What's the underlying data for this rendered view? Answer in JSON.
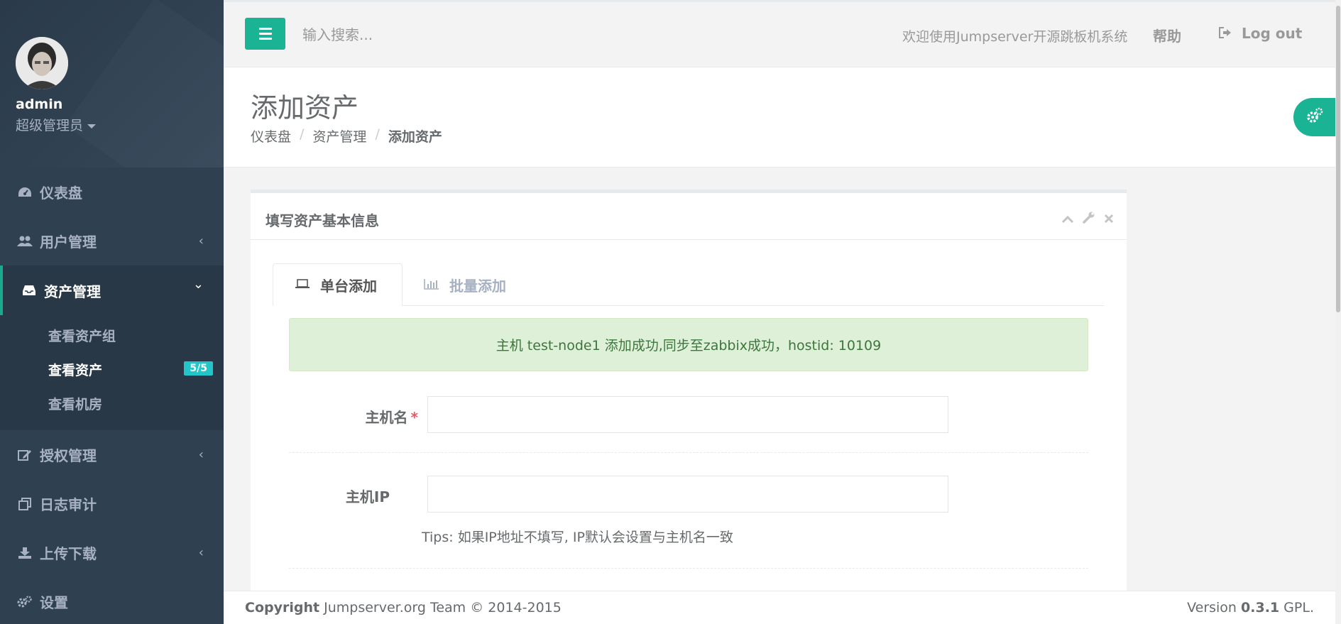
{
  "user": {
    "name": "admin",
    "role": "超级管理员"
  },
  "sidebar": {
    "items": [
      {
        "label": "仪表盘",
        "icon": "dashboard-icon"
      },
      {
        "label": "用户管理",
        "icon": "users-icon",
        "chevron": "‹"
      },
      {
        "label": "资产管理",
        "icon": "inbox-icon",
        "chevron": "⌄"
      },
      {
        "label": "授权管理",
        "icon": "edit-icon",
        "chevron": "‹"
      },
      {
        "label": "日志审计",
        "icon": "files-icon"
      },
      {
        "label": "上传下载",
        "icon": "download-icon",
        "chevron": "‹"
      },
      {
        "label": "设置",
        "icon": "cogs-icon"
      }
    ],
    "subitems": [
      {
        "label": "查看资产组"
      },
      {
        "label": "查看资产",
        "badge": "5/5"
      },
      {
        "label": "查看机房"
      }
    ]
  },
  "topbar": {
    "search_placeholder": "输入搜索...",
    "welcome": "欢迎使用Jumpserver开源跳板机系统",
    "help": "帮助",
    "logout": "Log out"
  },
  "page": {
    "title": "添加资产",
    "breadcrumb": [
      "仪表盘",
      "资产管理",
      "添加资产"
    ]
  },
  "panel": {
    "title": "填写资产基本信息",
    "tabs": [
      {
        "label": "单台添加",
        "icon": "laptop-icon"
      },
      {
        "label": "批量添加",
        "icon": "bar-chart-icon"
      }
    ],
    "alert": "主机 test-node1 添加成功,同步至zabbix成功，hostid: 10109",
    "fields": [
      {
        "label": "主机名",
        "required": "*",
        "value": ""
      },
      {
        "label": "主机IP",
        "value": ""
      }
    ],
    "tips": "Tips: 如果IP地址不填写, IP默认会设置与主机名一致"
  },
  "footer": {
    "copyright_bold": "Copyright",
    "copyright_rest": " Jumpserver.org Team © 2014-2015",
    "version_prefix": "Version ",
    "version_num": "0.3.1",
    "version_suffix": " GPL."
  },
  "colors": {
    "accent": "#1ab394",
    "sidebar": "#2f4050",
    "badge": "#23c6c8",
    "alert_bg": "#dff0d8"
  }
}
